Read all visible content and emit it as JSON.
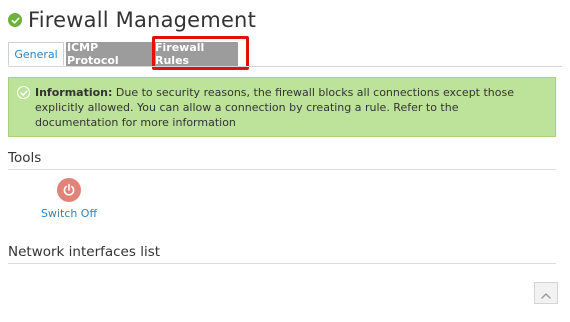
{
  "header": {
    "title": "Firewall Management",
    "status_icon": "check-circle-icon",
    "status_color": "#6cb13c"
  },
  "tabs": [
    {
      "label": "General",
      "active": true
    },
    {
      "label": "ICMP Protocol",
      "active": false
    },
    {
      "label": "Firewall Rules",
      "active": false,
      "highlighted": true
    }
  ],
  "info": {
    "icon": "check-circle-icon",
    "label": "Information:",
    "text": "Due to security reasons, the firewall blocks all connections except those explicitly allowed. You can allow a connection by creating a rule. Refer to the documentation for more information",
    "background": "#bde29a"
  },
  "tools": {
    "title": "Tools",
    "switch_off": {
      "label": "Switch Off",
      "icon": "power-icon",
      "color": "#e0847a"
    }
  },
  "interfaces": {
    "title": "Network interfaces list"
  },
  "scroll_top": {
    "icon": "chevron-up-icon"
  },
  "colors": {
    "accent": "#2e84c6",
    "highlight": "#e01010",
    "inactive_tab": "#9c9c9c"
  }
}
